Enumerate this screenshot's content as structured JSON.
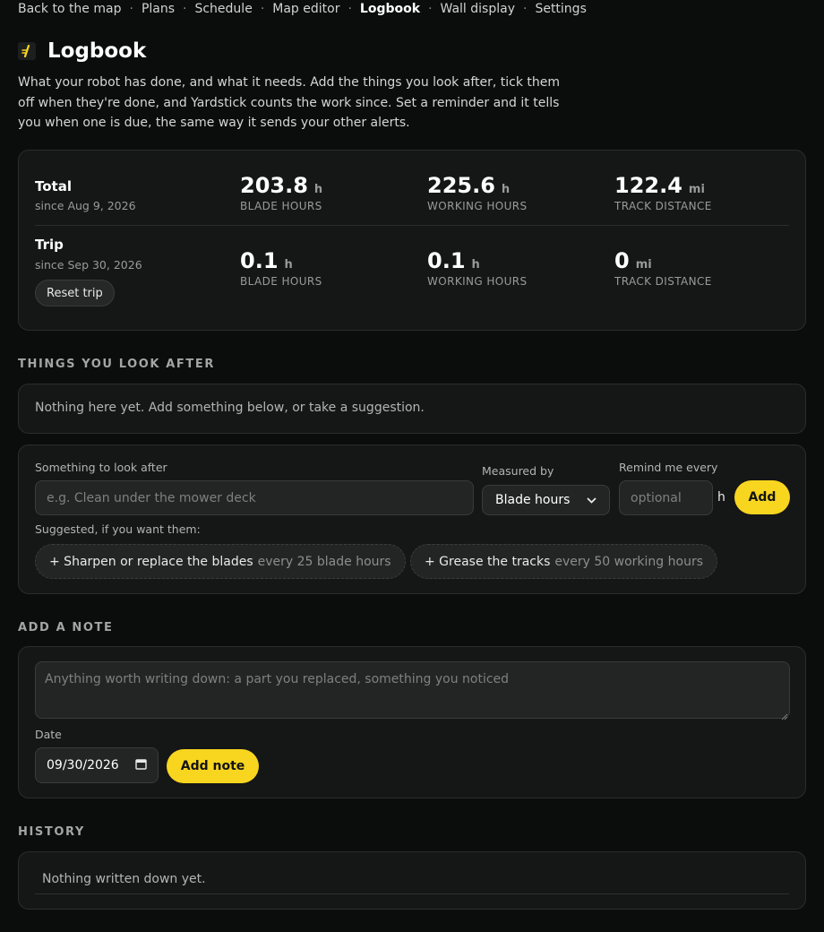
{
  "nav": {
    "items": [
      {
        "label": "Back to the map",
        "active": false
      },
      {
        "label": "Plans",
        "active": false
      },
      {
        "label": "Schedule",
        "active": false
      },
      {
        "label": "Map editor",
        "active": false
      },
      {
        "label": "Logbook",
        "active": true
      },
      {
        "label": "Wall display",
        "active": false
      },
      {
        "label": "Settings",
        "active": false
      }
    ],
    "separator": "·"
  },
  "header": {
    "icon": "yardstick-logo-icon",
    "title": "Logbook",
    "intro": "What your robot has done, and what it needs. Add the things you look after, tick them off when they're done, and Yardstick counts the work since. Set a reminder and it tells you when one is due, the same way it sends your other alerts."
  },
  "stats": {
    "total": {
      "label": "Total",
      "since": "since Aug 9, 2026",
      "blade": {
        "value": "203.8",
        "unit": "h",
        "caption": "BLADE HOURS"
      },
      "working": {
        "value": "225.6",
        "unit": "h",
        "caption": "WORKING HOURS"
      },
      "track": {
        "value": "122.4",
        "unit": "mi",
        "caption": "TRACK DISTANCE"
      }
    },
    "trip": {
      "label": "Trip",
      "since": "since Sep 30, 2026",
      "reset_label": "Reset trip",
      "blade": {
        "value": "0.1",
        "unit": "h",
        "caption": "BLADE HOURS"
      },
      "working": {
        "value": "0.1",
        "unit": "h",
        "caption": "WORKING HOURS"
      },
      "track": {
        "value": "0",
        "unit": "mi",
        "caption": "TRACK DISTANCE"
      }
    }
  },
  "look_after": {
    "heading": "THINGS YOU LOOK AFTER",
    "empty_text": "Nothing here yet. Add something below, or take a suggestion.",
    "form": {
      "name_label": "Something to look after",
      "name_placeholder": "e.g. Clean under the mower deck",
      "measured_label": "Measured by",
      "measured_value": "Blade hours",
      "remind_label": "Remind me every",
      "remind_placeholder": "optional",
      "remind_unit": "h",
      "add_label": "Add",
      "suggested_label": "Suggested, if you want them:",
      "suggestions": [
        {
          "label": "+ Sharpen or replace the blades",
          "freq": "every 25 blade hours"
        },
        {
          "label": "+ Grease the tracks",
          "freq": "every 50 working hours"
        }
      ]
    }
  },
  "note": {
    "heading": "ADD A NOTE",
    "placeholder": "Anything worth writing down: a part you replaced, something you noticed",
    "date_label": "Date",
    "date_value": "09/30/2026",
    "add_label": "Add note"
  },
  "history": {
    "heading": "HISTORY",
    "empty_text": "Nothing written down yet."
  },
  "colors": {
    "accent": "#f8d51f",
    "background": "#0b0c0c",
    "card": "#151616"
  }
}
